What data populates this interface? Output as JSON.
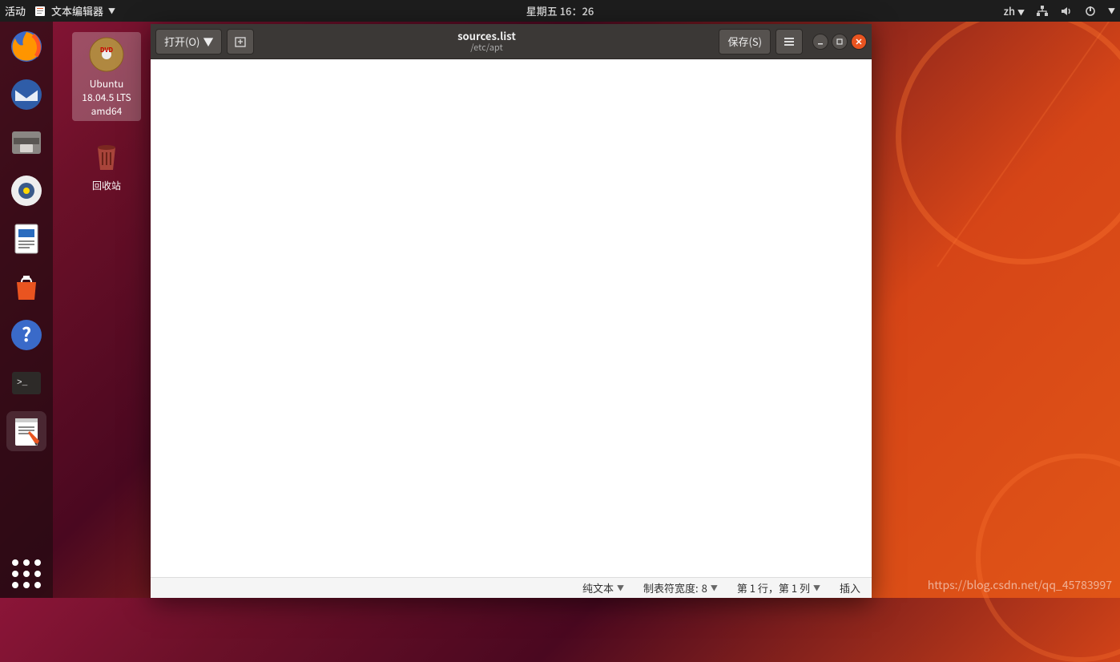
{
  "topbar": {
    "activities": "活动",
    "app_name": "文本编辑器",
    "datetime": "星期五 16：26",
    "input_lang": "zh"
  },
  "launcher": {
    "items": [
      {
        "name": "firefox"
      },
      {
        "name": "thunderbird"
      },
      {
        "name": "files"
      },
      {
        "name": "rhythmbox"
      },
      {
        "name": "writer"
      },
      {
        "name": "software"
      },
      {
        "name": "help"
      },
      {
        "name": "terminal"
      },
      {
        "name": "gedit",
        "active": true
      }
    ]
  },
  "desktop": {
    "dvd_label": "Ubuntu 18.04.5 LTS amd64",
    "trash_label": "回收站"
  },
  "gedit": {
    "open_label": "打开(O)",
    "save_label": "保存(S)",
    "filename": "sources.list",
    "filepath": "/etc/apt",
    "content": "",
    "status": {
      "syntax": "纯文本",
      "tabwidth_label": "制表符宽度:",
      "tabwidth_value": "8",
      "position": "第 1 行，第 1 列",
      "mode": "插入"
    }
  },
  "watermark": "https://blog.csdn.net/qq_45783997"
}
